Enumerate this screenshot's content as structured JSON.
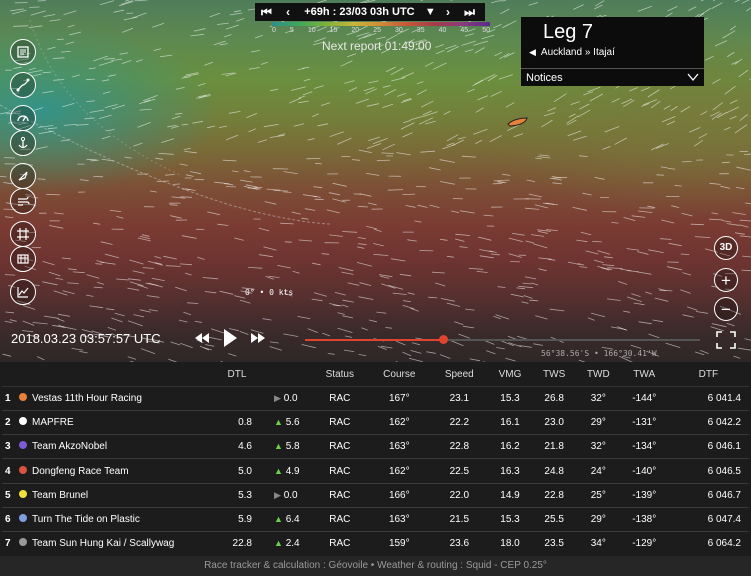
{
  "timebar": {
    "label": "+69h : 23/03 03h UTC",
    "first_icon": "skip-first-icon",
    "prev_icon": "step-back-icon",
    "next_icon": "step-forward-icon",
    "last_icon": "skip-last-icon"
  },
  "wind_legend": {
    "ticks": [
      "0",
      "5",
      "10",
      "15",
      "20",
      "25",
      "30",
      "35",
      "40",
      "45",
      "50"
    ]
  },
  "next_report": "Next report 01:49:00",
  "leg_panel": {
    "title": "Leg 7",
    "route": "Auckland » Itajaí",
    "notices_label": "Notices"
  },
  "map_tools": [
    "boat-list-icon",
    "route-icon",
    "gauge-icon",
    "anchor-icon",
    "compass-icon",
    "wind-icon",
    "grid-icon",
    "layers-icon",
    "chart-icon"
  ],
  "right_tools": {
    "view3d_label": "3D",
    "zoom_in": "+",
    "zoom_out": "−"
  },
  "cursor_readout": "0° • 0 kts",
  "coordinates": "56°38.56'S • 166°30.41'W",
  "playback": {
    "datetime": "2018.03.23 03:57:57 UTC",
    "progress": 0.35
  },
  "colors": {
    "accent": "#e0432e",
    "delta_up": "#69d04a",
    "boat": "#e8823a"
  },
  "ranking": {
    "headers": {
      "dtl": "DTL",
      "status": "Status",
      "course": "Course",
      "speed": "Speed",
      "vmg": "VMG",
      "tws": "TWS",
      "twd": "TWD",
      "twa": "TWA",
      "dtf": "DTF"
    },
    "rows": [
      {
        "rank": "1",
        "color": "#e8823a",
        "name": "Vestas 11th Hour Racing",
        "dtl": "",
        "trend": "flat",
        "delta": "0.0",
        "status": "RAC",
        "course": "167°",
        "speed": "23.1",
        "vmg": "15.3",
        "tws": "26.8",
        "twd": "32°",
        "twa": "-144°",
        "dtf": "6 041.4"
      },
      {
        "rank": "2",
        "color": "#ffffff",
        "name": "MAPFRE",
        "dtl": "0.8",
        "trend": "up",
        "delta": "5.6",
        "status": "RAC",
        "course": "162°",
        "speed": "22.2",
        "vmg": "16.1",
        "tws": "23.0",
        "twd": "29°",
        "twa": "-131°",
        "dtf": "6 042.2"
      },
      {
        "rank": "3",
        "color": "#7b5bd6",
        "name": "Team AkzoNobel",
        "dtl": "4.6",
        "trend": "up",
        "delta": "5.8",
        "status": "RAC",
        "course": "163°",
        "speed": "22.8",
        "vmg": "16.2",
        "tws": "21.8",
        "twd": "32°",
        "twa": "-134°",
        "dtf": "6 046.1"
      },
      {
        "rank": "4",
        "color": "#d9533f",
        "name": "Dongfeng Race Team",
        "dtl": "5.0",
        "trend": "up",
        "delta": "4.9",
        "status": "RAC",
        "course": "162°",
        "speed": "22.5",
        "vmg": "16.3",
        "tws": "24.8",
        "twd": "24°",
        "twa": "-140°",
        "dtf": "6 046.5"
      },
      {
        "rank": "5",
        "color": "#f2df3a",
        "name": "Team Brunel",
        "dtl": "5.3",
        "trend": "flat",
        "delta": "0.0",
        "status": "RAC",
        "course": "166°",
        "speed": "22.0",
        "vmg": "14.9",
        "tws": "22.8",
        "twd": "25°",
        "twa": "-139°",
        "dtf": "6 046.7"
      },
      {
        "rank": "6",
        "color": "#7f9ee0",
        "name": "Turn The Tide on Plastic",
        "dtl": "5.9",
        "trend": "up",
        "delta": "6.4",
        "status": "RAC",
        "course": "163°",
        "speed": "21.5",
        "vmg": "15.3",
        "tws": "25.5",
        "twd": "29°",
        "twa": "-138°",
        "dtf": "6 047.4"
      },
      {
        "rank": "7",
        "color": "#999999",
        "name": "Team Sun Hung Kai / Scallywag",
        "dtl": "22.8",
        "trend": "up",
        "delta": "2.4",
        "status": "RAC",
        "course": "159°",
        "speed": "23.6",
        "vmg": "18.0",
        "tws": "23.5",
        "twd": "34°",
        "twa": "-129°",
        "dtf": "6 064.2"
      }
    ]
  },
  "footer": "Race tracker & calculation : Géovoile • Weather & routing : Squid - CEP 0.25°"
}
